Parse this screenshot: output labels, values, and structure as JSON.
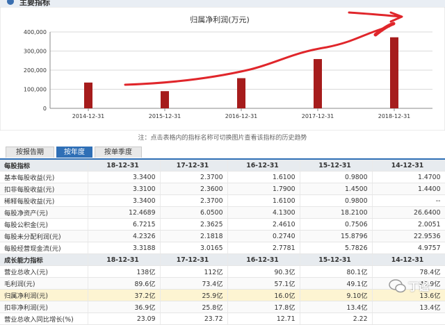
{
  "header": {
    "title": "主要指标"
  },
  "chart_data": {
    "type": "bar",
    "title": "归属净利润(万元)",
    "categories": [
      "2014-12-31",
      "2015-12-31",
      "2016-12-31",
      "2017-12-31",
      "2018-12-31"
    ],
    "values": [
      135000,
      90000,
      158000,
      258000,
      372000
    ],
    "ylim": [
      0,
      400000
    ],
    "yticks": [
      "0",
      "100,000",
      "200,000",
      "300,000",
      "400,000"
    ],
    "grid": true,
    "bar_color": "#a61c1c"
  },
  "annotation_color": "#e0262b",
  "note": "注：点击表格内的指标名称可切换图片查看该指标的历史趋势",
  "tabs": [
    {
      "label": "按报告期",
      "active": false
    },
    {
      "label": "按年度",
      "active": true
    },
    {
      "label": "按单季度",
      "active": false
    }
  ],
  "table": {
    "columns": [
      "18-12-31",
      "17-12-31",
      "16-12-31",
      "15-12-31",
      "14-12-31"
    ],
    "sections": [
      {
        "title": "每股指标",
        "rows": [
          {
            "label": "基本每股收益(元)",
            "values": [
              "3.3400",
              "2.3700",
              "1.6100",
              "0.9800",
              "1.4700"
            ]
          },
          {
            "label": "扣非每股收益(元)",
            "values": [
              "3.3100",
              "2.3600",
              "1.7900",
              "1.4500",
              "1.4400"
            ]
          },
          {
            "label": "稀释每股收益(元)",
            "values": [
              "3.3400",
              "2.3700",
              "1.6100",
              "0.9800",
              "--"
            ]
          },
          {
            "label": "每股净资产(元)",
            "values": [
              "12.4689",
              "6.0500",
              "4.1300",
              "18.2100",
              "26.6400"
            ]
          },
          {
            "label": "每股公积金(元)",
            "values": [
              "6.7215",
              "2.3625",
              "2.4610",
              "0.7506",
              "2.0051"
            ]
          },
          {
            "label": "每股未分配利润(元)",
            "values": [
              "4.2326",
              "2.1818",
              "0.2740",
              "15.8796",
              "22.9536"
            ]
          },
          {
            "label": "每股经营现金流(元)",
            "values": [
              "3.3188",
              "3.0165",
              "2.7781",
              "5.7826",
              "4.9757"
            ]
          }
        ]
      },
      {
        "title": "成长能力指标",
        "rows": [
          {
            "label": "营业总收入(元)",
            "values": [
              "138亿",
              "112亿",
              "90.3亿",
              "80.1亿",
              "78.4亿"
            ]
          },
          {
            "label": "毛利润(元)",
            "values": [
              "89.6亿",
              "73.4亿",
              "57.1亿",
              "49.1亿",
              "48.9亿"
            ]
          },
          {
            "label": "归属净利润(元)",
            "values": [
              "37.2亿",
              "25.9亿",
              "16.0亿",
              "9.10亿",
              "13.6亿"
            ],
            "highlight": true
          },
          {
            "label": "扣非净利润(元)",
            "values": [
              "36.9亿",
              "25.8亿",
              "17.8亿",
              "13.4亿",
              "13.4亿"
            ]
          },
          {
            "label": "营业总收入同比增长(%)",
            "values": [
              "23.09",
              "23.72",
              "12.71",
              "2.22",
              ""
            ]
          }
        ]
      }
    ]
  },
  "watermark": {
    "text": "丁谧"
  }
}
